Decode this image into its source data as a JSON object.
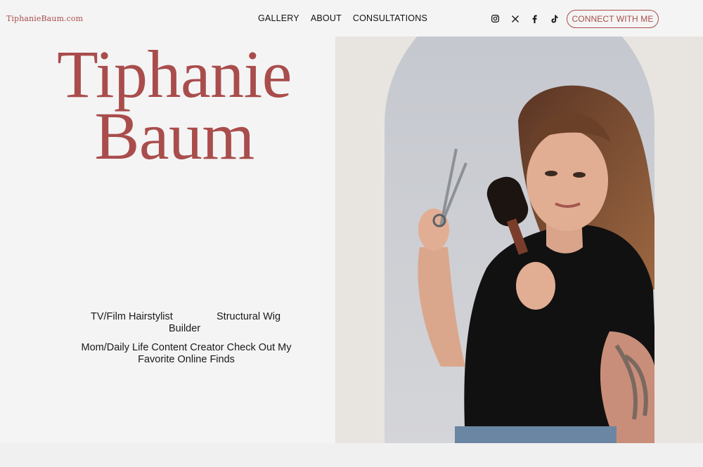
{
  "header": {
    "logo": "TiphanieBaum.com",
    "nav": [
      "GALLERY",
      "ABOUT",
      "CONSULTATIONS"
    ],
    "social_icons": [
      "instagram-icon",
      "x-icon",
      "facebook-icon",
      "tiktok-icon"
    ],
    "cta_label": "CONNECT WITH ME"
  },
  "hero": {
    "title_line1": "Tiphanie",
    "title_line2": "Baum",
    "roles": {
      "role1": "TV/Film Hairstylist",
      "role2": "Structural Wig",
      "role2_cont": "Builder",
      "role3": "Mom/Daily Life Content Creator Check Out My Favorite Online Finds"
    }
  },
  "colors": {
    "accent": "#a94d4c",
    "background": "#f4f4f4",
    "photo_backdrop": "#c9ccd3"
  }
}
